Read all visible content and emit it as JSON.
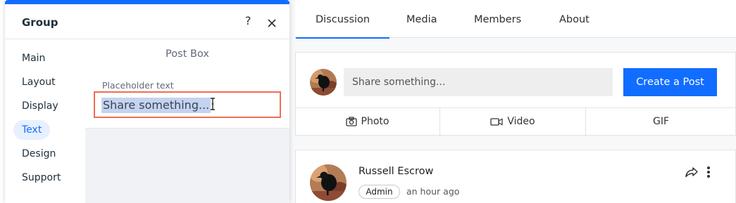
{
  "settings_panel": {
    "title": "Group",
    "help_icon": "?",
    "nav": [
      "Main",
      "Layout",
      "Display",
      "Text",
      "Design",
      "Support"
    ],
    "active_nav": "Text",
    "section_title": "Post Box",
    "placeholder_field": {
      "label": "Placeholder text",
      "value": "Share something..."
    },
    "accent_color": "#116dff",
    "highlight_color": "#ee6e55"
  },
  "group_page": {
    "tabs": [
      "Discussion",
      "Media",
      "Members",
      "About"
    ],
    "active_tab": "Discussion",
    "post_box": {
      "placeholder": "Share something...",
      "create_button": "Create a Post",
      "actions": [
        {
          "label": "Photo",
          "icon": "camera-icon"
        },
        {
          "label": "Video",
          "icon": "video-icon"
        },
        {
          "label": "GIF",
          "icon": ""
        }
      ]
    },
    "post": {
      "author": "Russell Escrow",
      "role": "Admin",
      "time": "an hour ago"
    }
  }
}
